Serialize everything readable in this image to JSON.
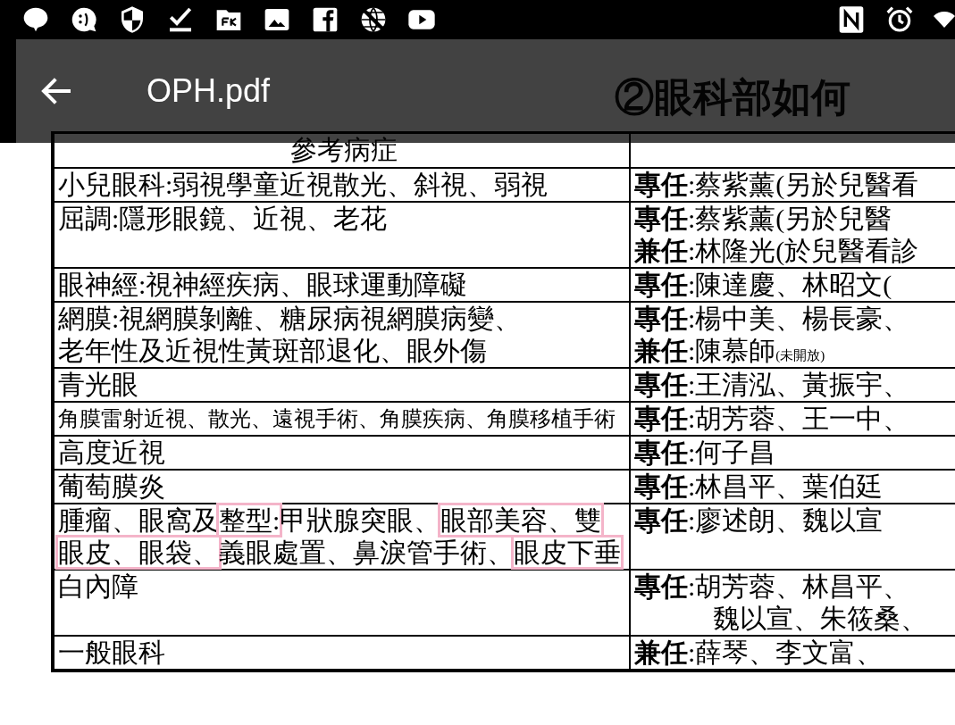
{
  "toolbar": {
    "title": "OPH.pdf"
  },
  "document": {
    "heading": "②眼科部如何",
    "table": {
      "header": "參考病症",
      "rows": [
        {
          "condition": {
            "lines": [
              "小兒眼科:弱視學童近視散光、斜視、弱視"
            ]
          },
          "staff": {
            "lines": [
              {
                "text": "**專任**:蔡紫薰(另於兒醫看"
              }
            ]
          }
        },
        {
          "condition": {
            "lines": [
              "屈調:隱形眼鏡、近視、老花"
            ]
          },
          "staff": {
            "lines": [
              {
                "text": "**專任**:蔡紫薰(另於兒醫"
              },
              {
                "text": "**兼任**:林隆光(於兒醫看診"
              }
            ]
          }
        },
        {
          "condition": {
            "lines": [
              "眼神經:視神經疾病、眼球運動障礙"
            ]
          },
          "staff": {
            "lines": [
              {
                "text": "**專任**:陳達慶、林昭文("
              }
            ]
          }
        },
        {
          "condition": {
            "lines": [
              "網膜:視網膜剝離、糖尿病視網膜病變、",
              "老年性及近視性黃斑部退化、眼外傷"
            ]
          },
          "staff": {
            "lines": [
              {
                "text": "**專任**:楊中美、楊長豪、"
              },
              {
                "text": "**兼任**:陳慕師",
                "note": "(未開放)"
              }
            ]
          }
        },
        {
          "condition": {
            "lines": [
              "青光眼"
            ]
          },
          "staff": {
            "lines": [
              {
                "text": "**專任**:王清泓、黃振宇、"
              }
            ]
          }
        },
        {
          "condition": {
            "lines": [
              "角膜雷射近視、散光、遠視手術、角膜疾病、角膜移植手術"
            ]
          },
          "staff": {
            "lines": [
              {
                "text": "**專任**:胡芳蓉、王一中、"
              }
            ]
          }
        },
        {
          "condition": {
            "lines": [
              "高度近視"
            ]
          },
          "staff": {
            "lines": [
              {
                "text": "**專任**:何子昌"
              }
            ]
          }
        },
        {
          "condition": {
            "lines": [
              "葡萄膜炎"
            ]
          },
          "staff": {
            "lines": [
              {
                "text": "**專任**:林昌平、葉伯廷"
              }
            ]
          }
        },
        {
          "condition": {
            "lines": [
              [
                {
                  "text": "腫瘤、眼窩及",
                  "boxed": false
                },
                {
                  "text": "整型:",
                  "boxed": true
                },
                {
                  "text": "甲狀腺突眼、",
                  "boxed": false
                },
                {
                  "text": "眼部美容、雙",
                  "boxed": true
                }
              ],
              [
                {
                  "text": "眼皮、眼袋、",
                  "boxed": true
                },
                {
                  "text": "義眼處置、鼻淚管手術、",
                  "boxed": false
                },
                {
                  "text": "眼皮下垂",
                  "boxed": true
                }
              ]
            ]
          },
          "staff": {
            "lines": [
              {
                "text": "**專任**:廖述朗、魏以宣"
              }
            ]
          }
        },
        {
          "condition": {
            "lines": [
              "白內障"
            ]
          },
          "staff": {
            "lines": [
              {
                "text": "**專任**:胡芳蓉、林昌平、"
              },
              {
                "text": "魏以宣、朱筱桑、",
                "indent": true
              }
            ]
          }
        },
        {
          "condition": {
            "lines": [
              "一般眼科"
            ]
          },
          "staff": {
            "lines": [
              {
                "text": "**兼任**:薛琴、李文富、"
              }
            ]
          }
        }
      ]
    }
  }
}
